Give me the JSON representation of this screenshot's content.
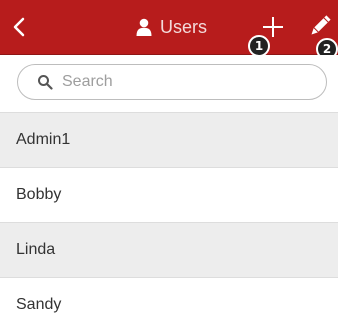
{
  "header": {
    "title": "Users",
    "background_color": "#b71c1c",
    "back_icon": "chevron-left-icon",
    "title_icon": "user-icon",
    "add_icon": "plus-icon",
    "edit_icon": "pencil-icon",
    "badges": [
      "1",
      "2"
    ]
  },
  "search": {
    "placeholder": "Search",
    "value": "",
    "icon": "search-icon"
  },
  "users": [
    "Admin1",
    "Bobby",
    "Linda",
    "Sandy"
  ]
}
